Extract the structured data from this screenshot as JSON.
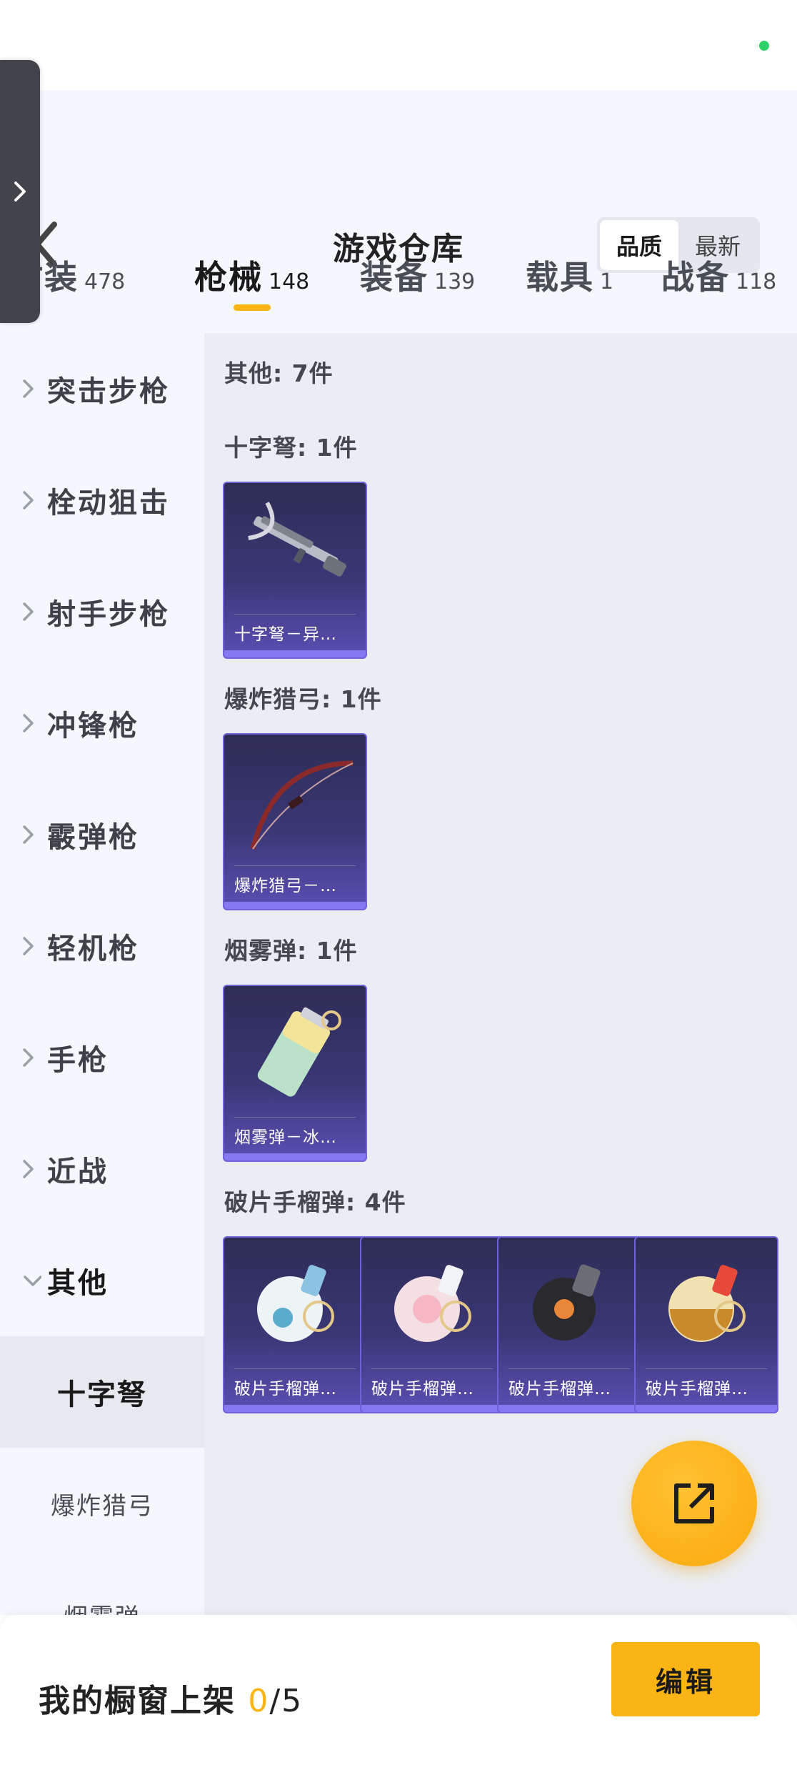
{
  "header": {
    "title": "游戏仓库",
    "sort_options": [
      "品质",
      "最新"
    ],
    "sort_selected": "品质"
  },
  "tabs": [
    {
      "label": "时装",
      "count": "478"
    },
    {
      "label": "枪械",
      "count": "148",
      "active": true
    },
    {
      "label": "装备",
      "count": "139"
    },
    {
      "label": "载具",
      "count": "1"
    },
    {
      "label": "战备",
      "count": "118"
    }
  ],
  "sidebar": {
    "categories": [
      {
        "label": "突击步枪"
      },
      {
        "label": "栓动狙击"
      },
      {
        "label": "射手步枪"
      },
      {
        "label": "冲锋枪"
      },
      {
        "label": "霰弹枪"
      },
      {
        "label": "轻机枪"
      },
      {
        "label": "手枪"
      },
      {
        "label": "近战"
      },
      {
        "label": "其他",
        "expanded": true
      }
    ],
    "subcategories": [
      {
        "label": "十字弩",
        "active": true
      },
      {
        "label": "爆炸猎弓"
      },
      {
        "label": "烟雾弹"
      }
    ]
  },
  "content": {
    "summary": "其他: 7件",
    "sections": [
      {
        "title": "十字弩: 1件",
        "items": [
          {
            "name": "十字弩－异…",
            "icon": "crossbow-icon"
          }
        ]
      },
      {
        "title": "爆炸猎弓: 1件",
        "items": [
          {
            "name": "爆炸猎弓－…",
            "icon": "bow-icon"
          }
        ]
      },
      {
        "title": "烟雾弹: 1件",
        "items": [
          {
            "name": "烟雾弹－冰…",
            "icon": "smoke-grenade-icon"
          }
        ]
      },
      {
        "title": "破片手榴弹: 4件",
        "items": [
          {
            "name": "破片手榴弹…",
            "icon": "grenade-icon"
          },
          {
            "name": "破片手榴弹…",
            "icon": "grenade-icon"
          },
          {
            "name": "破片手榴弹…",
            "icon": "grenade-icon"
          },
          {
            "name": "破片手榴弹…",
            "icon": "grenade-icon"
          }
        ]
      }
    ]
  },
  "footer": {
    "showcase_label": "我的橱窗上架",
    "showcase_count": "0",
    "showcase_total": "/5",
    "edit_label": "编辑"
  },
  "colors": {
    "accent": "#fbb415",
    "card_purple": "#3a3775",
    "status_green": "#2ed06a"
  }
}
